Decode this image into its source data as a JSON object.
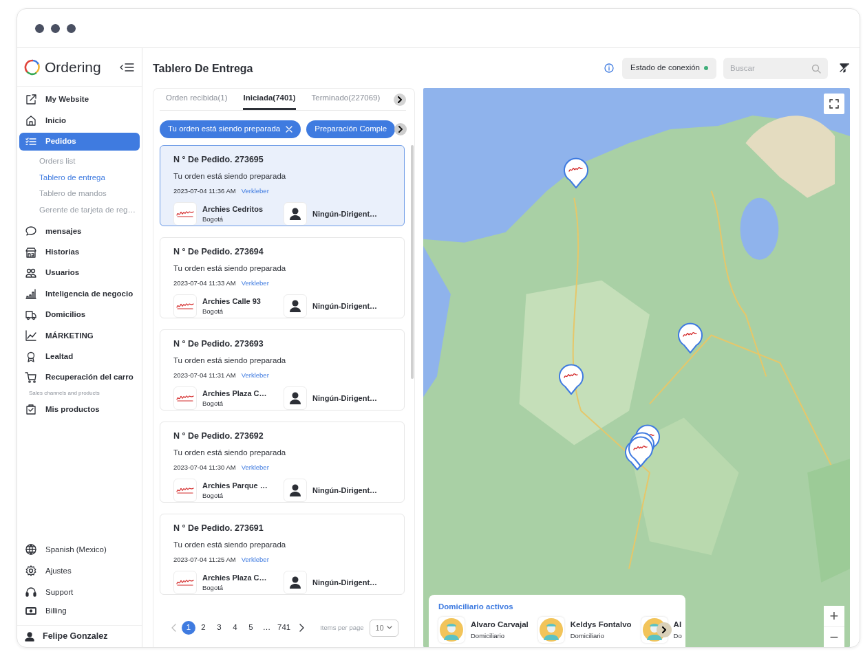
{
  "app": {
    "name": "Ordering"
  },
  "sidebar": {
    "items": [
      {
        "label": "My Website",
        "selected": false
      },
      {
        "label": "Inicio",
        "selected": false
      },
      {
        "label": "Pedidos",
        "selected": true,
        "children": [
          {
            "label": "Orders list",
            "selected": false
          },
          {
            "label": "Tablero de entrega",
            "selected": true
          },
          {
            "label": "Tablero de mandos",
            "selected": false
          },
          {
            "label": "Gerente de tarjeta de reg…",
            "selected": false
          }
        ]
      },
      {
        "label": "mensajes",
        "selected": false
      },
      {
        "label": "Historias",
        "selected": false
      },
      {
        "label": "Usuarios",
        "selected": false
      },
      {
        "label": "Inteligencia de negocio",
        "selected": false
      },
      {
        "label": "Domicilios",
        "selected": false
      },
      {
        "label": "MÁRKETING",
        "selected": false
      },
      {
        "label": "Lealtad",
        "selected": false
      },
      {
        "label": "Recuperación del carro",
        "selected": false
      }
    ],
    "section": "Sales channels and products",
    "section_items": [
      {
        "label": "Mis productos",
        "selected": false
      }
    ],
    "footer_items": [
      {
        "label": "Spanish (Mexico)"
      },
      {
        "label": "Ajustes"
      },
      {
        "label": "Support"
      },
      {
        "label": "Billing"
      }
    ],
    "user": "Felipe Gonzalez"
  },
  "header": {
    "title": "Tablero De Entrega",
    "connection": {
      "label": "Estado de conexión",
      "online": true
    },
    "search": {
      "placeholder": "Buscar"
    }
  },
  "tabs": [
    {
      "label": "Orden recibida(1)",
      "selected": false
    },
    {
      "label": "Iniciada(7401)",
      "selected": true
    },
    {
      "label": "Terminado(227069)",
      "selected": false
    }
  ],
  "filters": [
    {
      "label": "Tu orden está siendo preparada",
      "removable": true
    },
    {
      "label": "Preparación Comple",
      "removable": false
    }
  ],
  "orders": [
    {
      "number": "N ° De Pedido. 273695",
      "status": "Tu orden está siendo preparada",
      "datetime": "2023-07-04 11:36 AM",
      "tag": "Verkleber",
      "store": "Archies Cedritos",
      "city": "Bogotá",
      "driver": "Ningún-Dirigent…",
      "selected": true
    },
    {
      "number": "N ° De Pedido. 273694",
      "status": "Tu orden está siendo preparada",
      "datetime": "2023-07-04 11:33 AM",
      "tag": "Verkleber",
      "store": "Archies Calle 93",
      "city": "Bogotá",
      "driver": "Ningún-Dirigent…",
      "selected": false
    },
    {
      "number": "N ° De Pedido. 273693",
      "status": "Tu orden está siendo preparada",
      "datetime": "2023-07-04 11:31 AM",
      "tag": "Verkleber",
      "store": "Archies Plaza C…",
      "city": "Bogotá",
      "driver": "Ningún-Dirigent…",
      "selected": false
    },
    {
      "number": "N ° De Pedido. 273692",
      "status": "Tu orden está siendo preparada",
      "datetime": "2023-07-04 11:30 AM",
      "tag": "Verkleber",
      "store": "Archies Parque …",
      "city": "Bogotá",
      "driver": "Ningún-Dirigent…",
      "selected": false
    },
    {
      "number": "N ° De Pedido. 273691",
      "status": "Tu orden está siendo preparada",
      "datetime": "2023-07-04 11:25 AM",
      "tag": "Verkleber",
      "store": "Archies Plaza C…",
      "city": "Bogotá",
      "driver": "Ningún-Dirigent…",
      "selected": false
    }
  ],
  "pagination": {
    "pages": [
      {
        "label": "1",
        "selected": true
      },
      {
        "label": "2",
        "selected": false
      },
      {
        "label": "3",
        "selected": false
      },
      {
        "label": "4",
        "selected": false
      },
      {
        "label": "5",
        "selected": false
      },
      {
        "label": "…",
        "selected": false
      },
      {
        "label": "741",
        "selected": false
      }
    ],
    "items_per_page_label": "Items per page",
    "items_per_page": "10"
  },
  "map": {
    "couriers_title": "Domiciliario activos",
    "couriers": [
      {
        "name": "Alvaro Carvajal",
        "role": "Domiciliario"
      },
      {
        "name": "Keldys Fontalvo",
        "role": "Domiciliario"
      },
      {
        "name": "Al",
        "role": "Do"
      }
    ],
    "zoom_in": "+",
    "zoom_out": "−"
  }
}
